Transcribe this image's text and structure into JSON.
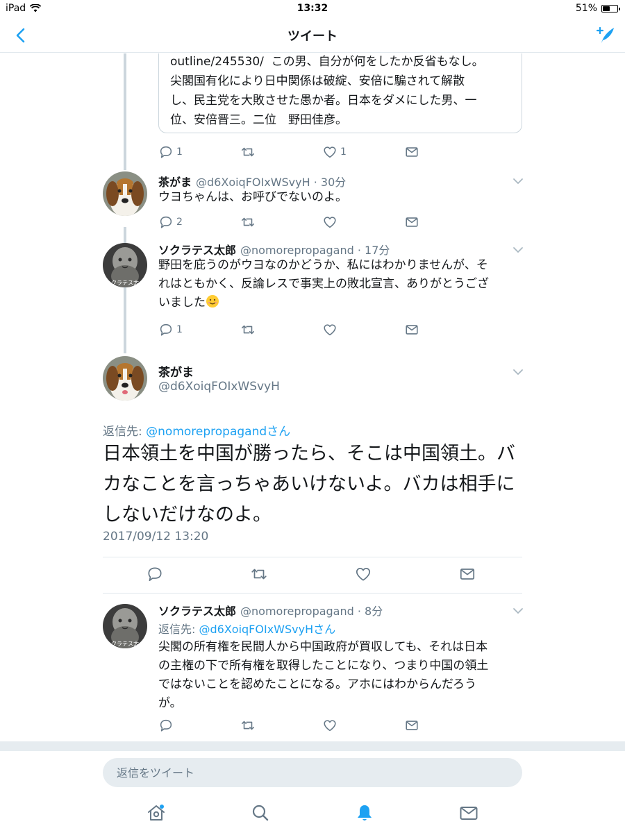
{
  "status_bar": {
    "device": "iPad",
    "time": "13:32",
    "battery_text": "51%",
    "battery_level": 0.51
  },
  "nav": {
    "title": "ツイート",
    "back_icon": "chevron-left-icon",
    "compose_icon": "compose-tweet-icon"
  },
  "colors": {
    "accent": "#1da1f2",
    "text": "#14171a",
    "secondary": "#657786",
    "border": "#e1e8ed"
  },
  "quoted_tweet": {
    "text": "outline/245530/  この男、自分が何をしたか反省もなし。\n尖閣国有化により日中関係は破綻、安倍に騙されて解散\nし、民主党を大敗させた愚か者。日本をダメにした男、一\n位、安倍晋三。二位　野田佳彦。",
    "reply_count": "1",
    "like_count": "1"
  },
  "tweets": [
    {
      "name": "茶がま",
      "handle": "@d6XoiqFOIxWSvyH · 30分",
      "text": "ウヨちゃんは、お呼びでないのよ。",
      "reply_count": "2",
      "like_count": ""
    },
    {
      "name": "ソクラテス太郎",
      "handle": "@nomorepropagand · 17分",
      "text_line1": "野田を庇うのがウヨなのかどうか、私にはわかりませんが、そ",
      "text_line2": "れはともかく、反論レスで事実上の敗北宣言、ありがとうござ",
      "text_line3": "いました",
      "avatar_caption": "クラテス太",
      "reply_count": "1",
      "like_count": ""
    }
  ],
  "main_tweet": {
    "name": "茶がま",
    "handle": "@d6XoiqFOIxWSvyH",
    "reply_prefix": "返信先: ",
    "reply_target": "@nomorepropagandさん",
    "text": "日本領土を中国が勝ったら、そこは中国領土。バカなことを言っちゃあいけないよ。バカは相手にしないだけなのよ。",
    "timestamp": "2017/09/12 13:20"
  },
  "reply_tweet": {
    "name": "ソクラテス太郎",
    "handle": "@nomorepropagand · 8分",
    "reply_prefix": "返信先: ",
    "reply_target": "@d6XoiqFOIxWSvyHさん",
    "text_line1": "尖閣の所有権を民間人から中国政府が買収しても、それは日本",
    "text_line2": "の主権の下で所有権を取得したことになり、つまり中国の領土",
    "text_line3": "ではないことを認めたことになる。アホにはわからんだろう",
    "text_line4": "が。",
    "avatar_caption": "クラテス太"
  },
  "composer": {
    "placeholder": "返信をツイート"
  },
  "tabs": [
    "home-icon",
    "search-icon",
    "notifications-bell-icon",
    "messages-icon"
  ]
}
